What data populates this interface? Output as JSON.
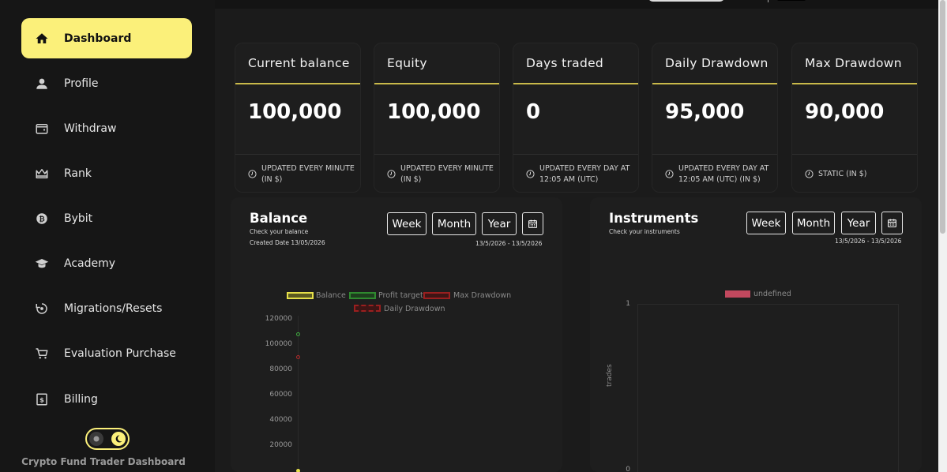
{
  "sidebar": {
    "items": [
      {
        "label": "Dashboard",
        "icon": "home-icon",
        "active": true
      },
      {
        "label": "Profile",
        "icon": "user-icon"
      },
      {
        "label": "Withdraw",
        "icon": "wallet-icon"
      },
      {
        "label": "Rank",
        "icon": "crown-icon"
      },
      {
        "label": "Bybit",
        "icon": "bitcoin-icon"
      },
      {
        "label": "Academy",
        "icon": "graduation-cap-icon"
      },
      {
        "label": "Migrations/Resets",
        "icon": "reset-icon"
      },
      {
        "label": "Evaluation Purchase",
        "icon": "cart-icon"
      },
      {
        "label": "Billing",
        "icon": "billing-icon"
      }
    ],
    "footer": "Crypto Fund Trader Dashboard"
  },
  "stats": [
    {
      "title": "Current balance",
      "value": "100,000",
      "note": "Updated every minute (in $)"
    },
    {
      "title": "Equity",
      "value": "100,000",
      "note": "Updated every minute (in $)"
    },
    {
      "title": "Days traded",
      "value": "0",
      "note": "Updated every day at 12:05 AM (UTC)"
    },
    {
      "title": "Daily Drawdown",
      "value": "95,000",
      "note": "Updated every day at 12:05 AM (UTC) (in $)"
    },
    {
      "title": "Max Drawdown",
      "value": "90,000",
      "note": "Static (in $)"
    }
  ],
  "balance_panel": {
    "title": "Balance",
    "subtitle": "Check your balance",
    "created": "Created Date 13/05/2026",
    "buttons": [
      "Week",
      "Month",
      "Year"
    ],
    "range": "13/5/2026 - 13/5/2026",
    "legend": [
      {
        "name": "Balance",
        "color": "#e6e04a"
      },
      {
        "name": "Profit target",
        "color": "#2f8a2f"
      },
      {
        "name": "Max Drawdown",
        "color": "#9a1f1f"
      },
      {
        "name": "Daily Drawdown",
        "color": "#9a1f1f"
      }
    ],
    "yticks": [
      "120000",
      "100000",
      "80000",
      "60000",
      "40000",
      "20000"
    ]
  },
  "instruments_panel": {
    "title": "Instruments",
    "subtitle": "Check your instruments",
    "buttons": [
      "Week",
      "Month",
      "Year"
    ],
    "range": "13/5/2026 - 13/5/2026",
    "legend": "undefined",
    "ylabel": "trades",
    "yticks": [
      "1",
      "0"
    ]
  },
  "colors": {
    "accent": "#fbf07a",
    "card_rule": "#c9b94a"
  }
}
